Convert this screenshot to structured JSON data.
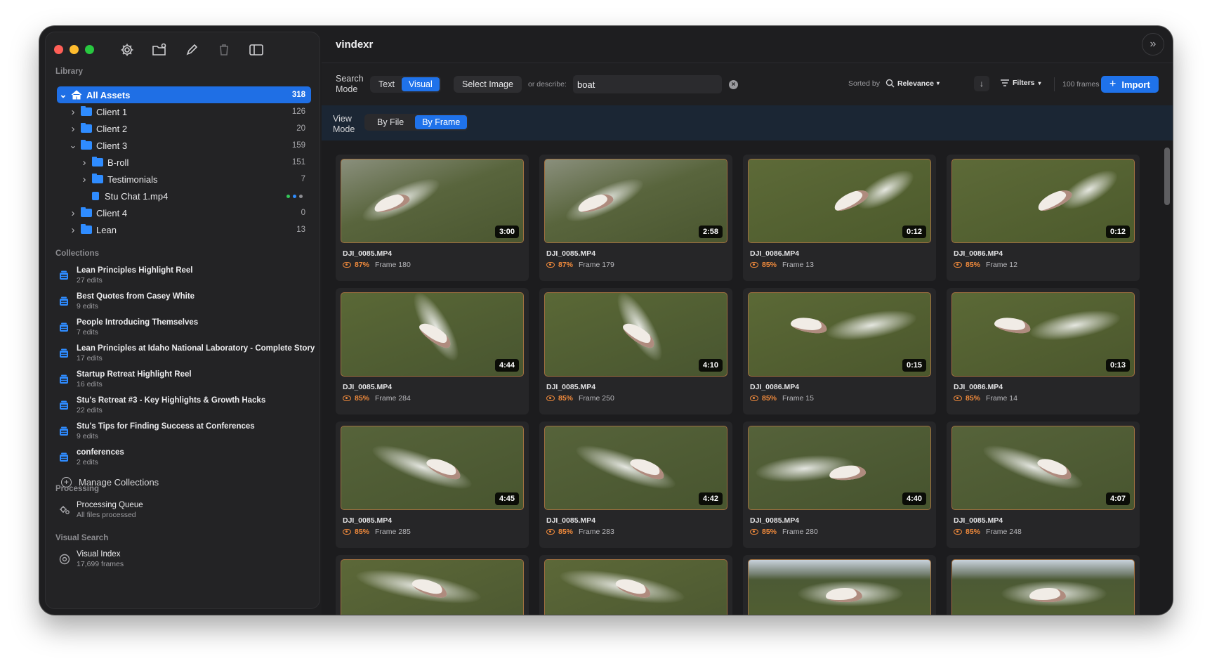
{
  "sidebar": {
    "library_title": "Library",
    "tree": [
      {
        "label": "All Assets",
        "count": "318",
        "selected": true,
        "depth": 0,
        "kind": "home",
        "chev": "down"
      },
      {
        "label": "Client 1",
        "count": "126",
        "depth": 1,
        "kind": "folder",
        "chev": "right"
      },
      {
        "label": "Client 2",
        "count": "20",
        "depth": 1,
        "kind": "folder",
        "chev": "right"
      },
      {
        "label": "Client 3",
        "count": "159",
        "depth": 1,
        "kind": "folder",
        "chev": "down"
      },
      {
        "label": "B-roll",
        "count": "151",
        "depth": 2,
        "kind": "folder",
        "chev": "right"
      },
      {
        "label": "Testimonials",
        "count": "7",
        "depth": 2,
        "kind": "folder",
        "chev": "right"
      },
      {
        "label": "Stu Chat 1.mp4",
        "count": "",
        "depth": 2,
        "kind": "file",
        "chev": "",
        "dots": [
          "#34c759",
          "#2f8cff",
          "#8e8e93"
        ]
      },
      {
        "label": "Client 4",
        "count": "0",
        "depth": 1,
        "kind": "folder",
        "chev": "right"
      },
      {
        "label": "Lean",
        "count": "13",
        "depth": 1,
        "kind": "folder",
        "chev": "right"
      }
    ],
    "collections_title": "Collections",
    "collections": [
      {
        "title": "Lean Principles Highlight Reel",
        "sub": "27 edits"
      },
      {
        "title": "Best Quotes from Casey White",
        "sub": "9 edits"
      },
      {
        "title": "People Introducing Themselves",
        "sub": "7 edits"
      },
      {
        "title": "Lean Principles at Idaho National Laboratory - Complete Story",
        "sub": "17 edits"
      },
      {
        "title": "Startup Retreat Highlight Reel",
        "sub": "16 edits"
      },
      {
        "title": "Stu's Retreat #3 - Key Highlights & Growth Hacks",
        "sub": "22 edits"
      },
      {
        "title": "Stu's Tips for Finding Success at Conferences",
        "sub": "9 edits"
      },
      {
        "title": "conferences",
        "sub": "2 edits"
      }
    ],
    "manage_collections": "Manage Collections",
    "processing_title": "Processing",
    "processing_queue": {
      "title": "Processing Queue",
      "sub": "All files processed"
    },
    "visual_search_title": "Visual Search",
    "visual_index": {
      "title": "Visual Index",
      "sub": "17,699 frames"
    }
  },
  "header": {
    "app_title": "vindexr"
  },
  "search": {
    "mode_label_1": "Search",
    "mode_label_2": "Mode",
    "mode_text": "Text",
    "mode_visual": "Visual",
    "select_image": "Select Image",
    "describe_label": "or describe:",
    "query": "boat",
    "sorted_by_label": "Sorted by",
    "sort_value": "Relevance",
    "filters_label": "Filters",
    "frame_count": "100 frames",
    "import_label": "Import"
  },
  "view": {
    "mode_label_1": "View",
    "mode_label_2": "Mode",
    "by_file": "By File",
    "by_frame": "By Frame"
  },
  "results": [
    {
      "file": "DJI_0085.MP4",
      "score": "87%",
      "frame": "Frame 180",
      "duration": "3:00",
      "scene": "a"
    },
    {
      "file": "DJI_0085.MP4",
      "score": "87%",
      "frame": "Frame 179",
      "duration": "2:58",
      "scene": "a"
    },
    {
      "file": "DJI_0086.MP4",
      "score": "85%",
      "frame": "Frame 13",
      "duration": "0:12",
      "scene": "b"
    },
    {
      "file": "DJI_0086.MP4",
      "score": "85%",
      "frame": "Frame 12",
      "duration": "0:12",
      "scene": "b"
    },
    {
      "file": "DJI_0085.MP4",
      "score": "85%",
      "frame": "Frame 284",
      "duration": "4:44",
      "scene": "c"
    },
    {
      "file": "DJI_0085.MP4",
      "score": "85%",
      "frame": "Frame 250",
      "duration": "4:10",
      "scene": "c"
    },
    {
      "file": "DJI_0086.MP4",
      "score": "85%",
      "frame": "Frame 15",
      "duration": "0:15",
      "scene": "d"
    },
    {
      "file": "DJI_0086.MP4",
      "score": "85%",
      "frame": "Frame 14",
      "duration": "0:13",
      "scene": "d"
    },
    {
      "file": "DJI_0085.MP4",
      "score": "85%",
      "frame": "Frame 285",
      "duration": "4:45",
      "scene": "e"
    },
    {
      "file": "DJI_0085.MP4",
      "score": "85%",
      "frame": "Frame 283",
      "duration": "4:42",
      "scene": "e"
    },
    {
      "file": "DJI_0085.MP4",
      "score": "85%",
      "frame": "Frame 280",
      "duration": "4:40",
      "scene": "f"
    },
    {
      "file": "DJI_0085.MP4",
      "score": "85%",
      "frame": "Frame 248",
      "duration": "4:07",
      "scene": "e"
    },
    {
      "file": "",
      "score": "",
      "frame": "",
      "duration": "",
      "scene": "g"
    },
    {
      "file": "",
      "score": "",
      "frame": "",
      "duration": "",
      "scene": "g"
    },
    {
      "file": "",
      "score": "",
      "frame": "",
      "duration": "",
      "scene": "h"
    },
    {
      "file": "",
      "score": "",
      "frame": "",
      "duration": "",
      "scene": "h"
    }
  ],
  "colors": {
    "accent": "#1f72ea",
    "score": "#f08a3c",
    "folder": "#2f8cff",
    "water": "#4d5a34"
  }
}
